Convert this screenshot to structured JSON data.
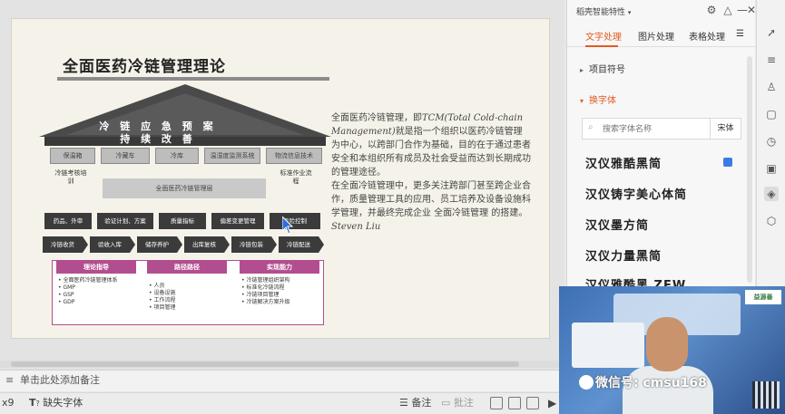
{
  "slide": {
    "title": "全面医药冷链管理理论",
    "roof_line1": "冷 链 应 急 预 案",
    "roof_line2": "持 续 改 善",
    "caps": [
      "保温箱",
      "冷藏车",
      "冷库",
      "温湿度监测系统",
      "物流信息技术"
    ],
    "left_pillar": "冷链考核培训",
    "right_pillar": "标准作业流程",
    "center_band": "全面医药冷链管理层",
    "dark_boxes": [
      "药品、外审",
      "验证计划、方案",
      "质量指标",
      "偏差变更管理",
      "风险控制"
    ],
    "arrows": [
      "冷链收货",
      "验收入库",
      "储存养护",
      "出库复核",
      "冷链包装",
      "冷链配送"
    ],
    "panel_heads": [
      "理论指导",
      "路径路径",
      "实现能力"
    ],
    "panel_col1": [
      "全面医药冷链管理体系",
      "GMP",
      "GSP",
      "GDP"
    ],
    "panel_col2": [
      "人员",
      "设备设施",
      "工作流程",
      "项目管理"
    ],
    "panel_col3": [
      "冷链管理组织架构",
      "标准化冷链流程",
      "冷链项目管理",
      "冷链解决方案升级"
    ],
    "paragraph": {
      "p1a": "全面医药冷链管理，即",
      "p1b": "TCM(Total Cold-chain Management)",
      "p1c": "就是指一个组织以医药冷链管理为中心，以跨部门合作为基础，目的在于通过患者安全和本组织所有成员及社会受益而达到长期成功的管理途径。",
      "p2": "在全面冷链管理中，更多关注跨部门甚至跨企业合作，质量管理工具的应用、员工培养及设备设施科学管理，并最终完成企业 全面冷链管理 的搭建。",
      "author": "Steven Liu"
    }
  },
  "notes_bar": {
    "placeholder": "单击此处添加备注"
  },
  "status_bar": {
    "left_fragment": "x9",
    "missing_font": "缺失字体",
    "notes_btn": "备注",
    "comment_btn": "批注"
  },
  "pane": {
    "title": "稻壳智能特性",
    "tabs": [
      "文字处理",
      "图片处理",
      "表格处理"
    ],
    "active_tab": 0,
    "sections": [
      "项目符号",
      "换字体"
    ],
    "search_placeholder": "搜索字体名称",
    "font_kind": "宋体",
    "fonts": [
      "汉仪雅酷黑简",
      "汉仪铸字美心体简",
      "汉仪墨方简",
      "汉仪力量黑简",
      "汉仪雅酷黑 ZEW"
    ]
  },
  "webcam": {
    "watermark": "微信号: cmsu168",
    "logo": "益源善"
  },
  "colors": {
    "accent": "#e25b1f",
    "diagram_dark": "#3b3b3b",
    "panel_magenta": "#b24e8f"
  },
  "icons": [
    "settings-icon",
    "pin-icon",
    "minimize-icon",
    "close-icon",
    "menu-icon",
    "search-icon"
  ]
}
